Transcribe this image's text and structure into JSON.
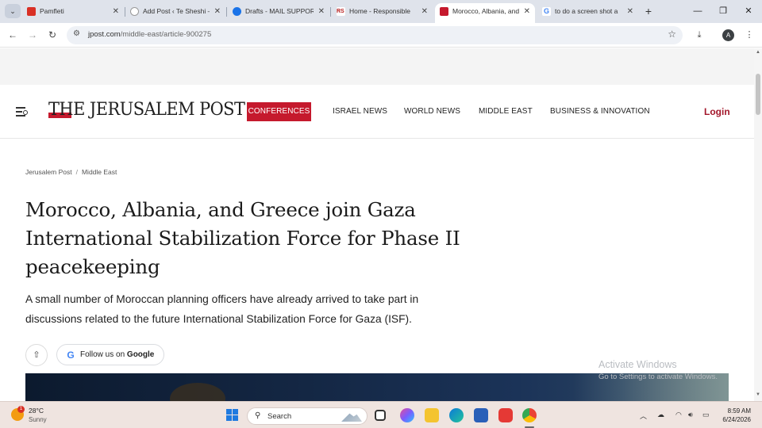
{
  "tabs": [
    {
      "title": "Pamfleti",
      "color": "#d93025",
      "active": false
    },
    {
      "title": "Add Post ‹ Te Sheshi —",
      "color": "#9e9e9e",
      "active": false
    },
    {
      "title": "Drafts - MAIL SUPPORT",
      "color": "#1a73e8",
      "active": false
    },
    {
      "title": "Home - Responsible",
      "color": "#b71c1c",
      "active": false
    },
    {
      "title": "Morocco, Albania, and",
      "color": "#c5192d",
      "active": true
    },
    {
      "title": "to do a screen shot a",
      "color": "#4285f4",
      "active": false
    }
  ],
  "browser": {
    "url_host": "jpost.com",
    "url_path": "/middle-east/article-900275",
    "profile_initial": "A"
  },
  "site": {
    "logo_text": "THE JERUSALEM POST",
    "conferences_label": "CONFERENCES",
    "nav": [
      "ISRAEL NEWS",
      "WORLD NEWS",
      "MIDDLE EAST",
      "BUSINESS & INNOVATION"
    ],
    "login_label": "Login",
    "accent_color": "#c5192d"
  },
  "article": {
    "breadcrumb": [
      "Jerusalem Post",
      "Middle East"
    ],
    "headline_lines": [
      "Morocco, Albania, and Greece join Gaza",
      "International Stabilization Force for Phase II",
      "peacekeeping"
    ],
    "dek_lines": [
      "A small number of Moroccan planning officers have already arrived to take part in",
      "discussions related to the future International Stabilization Force for Gaza (ISF)."
    ],
    "follow_prefix": "Follow us on ",
    "follow_brand": "Google"
  },
  "watermark": {
    "title": "Activate Windows",
    "subtitle": "Go to Settings to activate Windows."
  },
  "taskbar": {
    "temperature": "28°C",
    "condition": "Sunny",
    "weather_badge": "1",
    "search_placeholder": "Search",
    "time": "8:59 AM",
    "date": "6/24/2026"
  }
}
